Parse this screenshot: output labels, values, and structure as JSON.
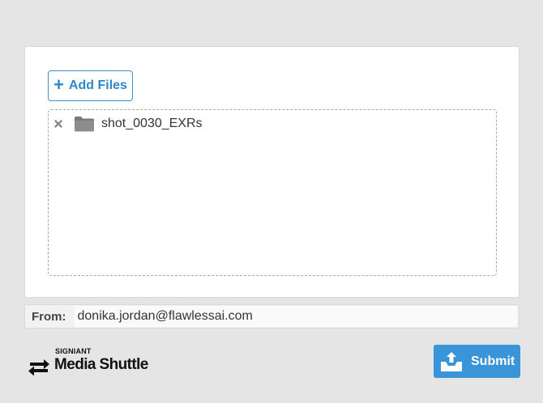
{
  "upload": {
    "add_files_label": "Add Files",
    "add_icon": "plus-icon",
    "files": [
      {
        "name": "shot_0030_EXRs",
        "icon": "folder-icon",
        "remove_icon": "close-icon"
      }
    ]
  },
  "from": {
    "label": "From:",
    "value": "donika.jordan@flawlessai.com"
  },
  "branding": {
    "company": "SIGNIANT",
    "product": "Media Shuttle",
    "icon": "transfer-arrows-icon"
  },
  "actions": {
    "submit_label": "Submit",
    "submit_icon": "upload-tray-icon"
  },
  "colors": {
    "accent": "#3a94d8",
    "background": "#e5e5e5",
    "panel": "#ffffff"
  }
}
